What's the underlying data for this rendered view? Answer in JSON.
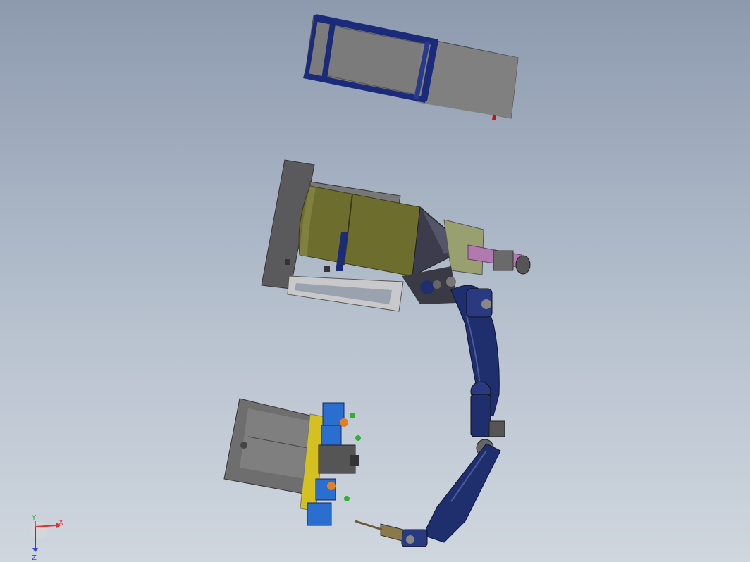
{
  "scene": {
    "type": "3D CAD assembly view",
    "background_top": "#8d9aae",
    "background_bottom": "#cfd6de"
  },
  "components": {
    "frame_tray": {
      "color_frame": "#1c2a7a",
      "color_panel": "#7a7a7a"
    },
    "cone_hopper": {
      "color_body": "#6b6b2a",
      "color_cone": "#3a3a4a",
      "color_pipe": "#b07ab0"
    },
    "robot_arm": {
      "color": "#1f2f6e"
    },
    "fixture_table": {
      "color_plate": "#6e6e6e",
      "color_clamps": "#2a6fd0",
      "color_accent": "#d4c020"
    }
  },
  "triad": {
    "x_label": "X",
    "y_label": "Y",
    "z_label": "Z",
    "x_color": "#e03030",
    "y_color": "#30b030",
    "z_color": "#3040e0"
  }
}
